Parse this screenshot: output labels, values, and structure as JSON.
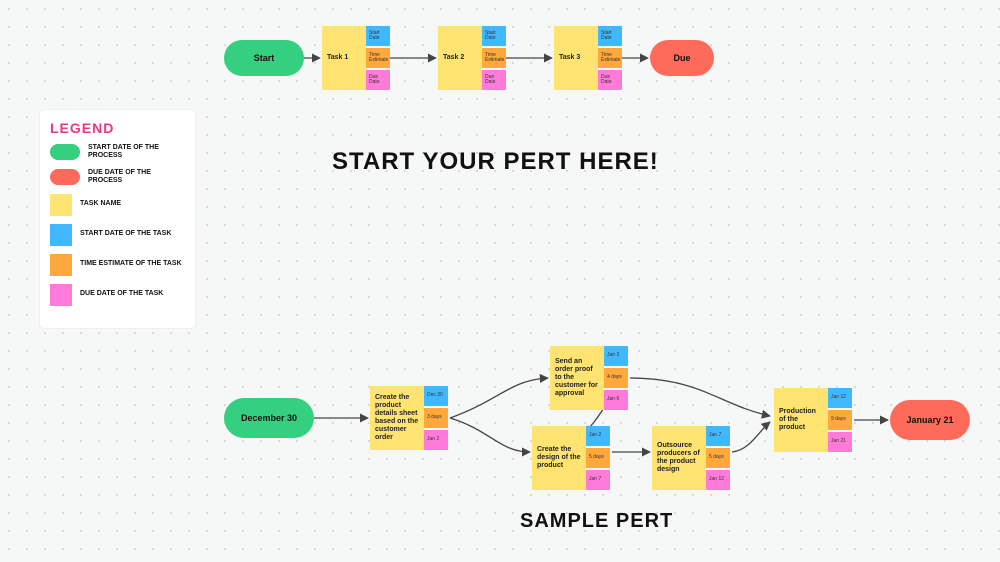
{
  "headings": {
    "top": "START YOUR PERT HERE!",
    "bottom": "SAMPLE PERT"
  },
  "legend": {
    "title": "LEGEND",
    "items": [
      {
        "label": "START DATE OF THE PROCESS"
      },
      {
        "label": "DUE DATE OF THE PROCESS"
      },
      {
        "label": "TASK NAME"
      },
      {
        "label": "START DATE OF THE TASK"
      },
      {
        "label": "TIME ESTIMATE OF THE TASK"
      },
      {
        "label": "DUE DATE OF THE TASK"
      }
    ]
  },
  "template": {
    "start": "Start",
    "due": "Due",
    "nodes": [
      {
        "task": "Task 1",
        "start": "Start Date",
        "time": "Time Estimate",
        "due": "Due Date"
      },
      {
        "task": "Task 2",
        "start": "Start Date",
        "time": "Time Estimate",
        "due": "Due Date"
      },
      {
        "task": "Task 3",
        "start": "Start Date",
        "time": "Time Estimate",
        "due": "Due Date"
      }
    ]
  },
  "sample": {
    "start": "December 30",
    "due": "January 21",
    "nodes": {
      "n0": {
        "task": "Create the product details sheet based on the customer order",
        "start": "Dec 30",
        "time": "3 days",
        "due": "Jan 2"
      },
      "n1": {
        "task": "Send an order proof to the customer for approval",
        "start": "Jan 2",
        "time": "4 days",
        "due": "Jan 6"
      },
      "n2": {
        "task": "Create the design of the product",
        "start": "Jan 2",
        "time": "5 days",
        "due": "Jan 7"
      },
      "n3": {
        "task": "Outsource producers of the product design",
        "start": "Jan 7",
        "time": "5 days",
        "due": "Jan 12"
      },
      "n4": {
        "task": "Production of the product",
        "start": "Jan 12",
        "time": "9 days",
        "due": "Jan 21"
      }
    }
  }
}
